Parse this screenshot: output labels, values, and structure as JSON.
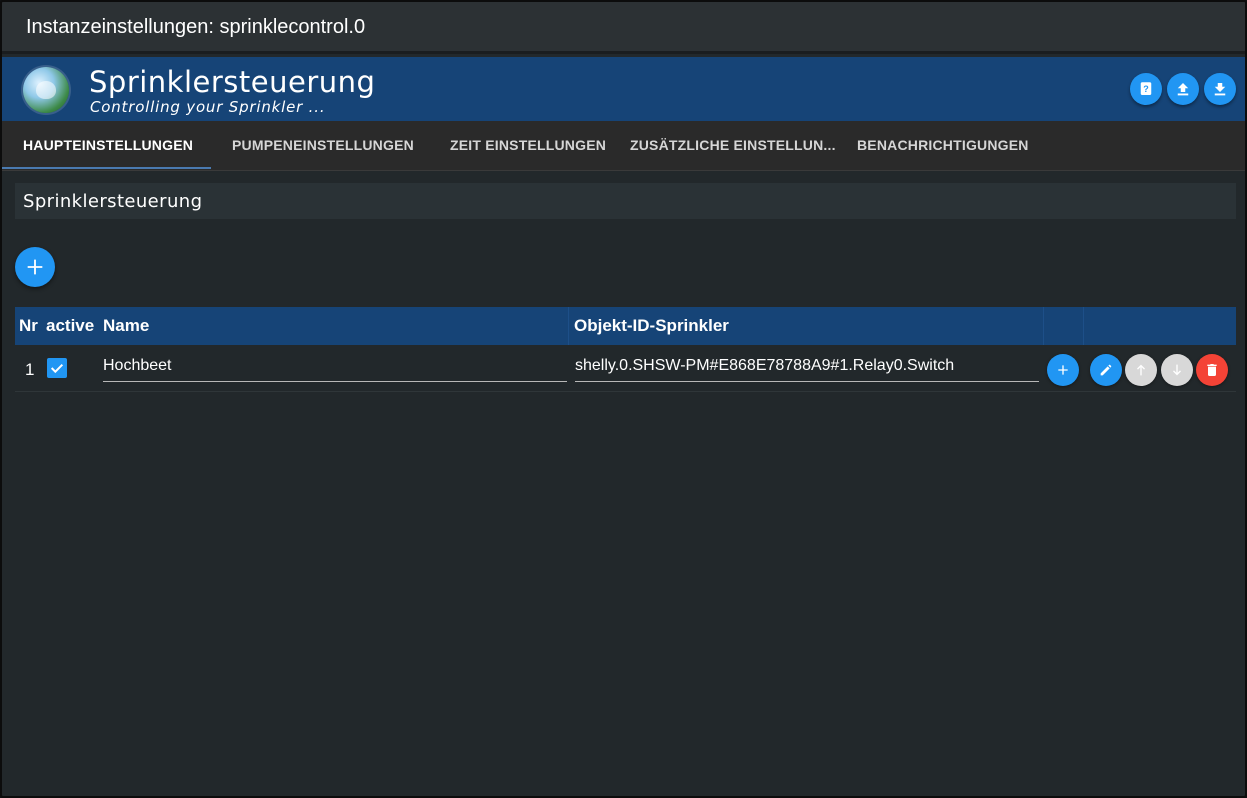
{
  "window": {
    "title": "Instanzeinstellungen: sprinklecontrol.0"
  },
  "header": {
    "logo_icon": "sprinkler-globe-logo",
    "title": "Sprinklersteuerung",
    "subtitle": "Controlling your Sprinkler ...",
    "buttons": [
      "help-icon",
      "upload-icon",
      "download-icon"
    ]
  },
  "tabs": [
    {
      "label": "HAUPTEINSTELLUNGEN",
      "active": true
    },
    {
      "label": "PUMPENEINSTELLUNGEN",
      "active": false
    },
    {
      "label": "ZEIT EINSTELLUNGEN",
      "active": false
    },
    {
      "label": "ZUSÄTZLICHE EINSTELLUN...",
      "active": false
    },
    {
      "label": "BENACHRICHTIGUNGEN",
      "active": false
    }
  ],
  "section": {
    "title": "Sprinklersteuerung"
  },
  "table": {
    "columns": {
      "nr": "Nr",
      "active": "active",
      "name": "Name",
      "object_id": "Objekt-ID-Sprinkler"
    },
    "rows": [
      {
        "nr": "1",
        "active": true,
        "name": "Hochbeet",
        "object_id": "shelly.0.SHSW-PM#E868E78788A9#1.Relay0.Switch"
      }
    ]
  },
  "colors": {
    "header_blue": "#164477",
    "accent_blue": "#2196f3",
    "delete_red": "#f44336",
    "disabled_grey": "#d8d8d8",
    "background": "#22282b"
  }
}
